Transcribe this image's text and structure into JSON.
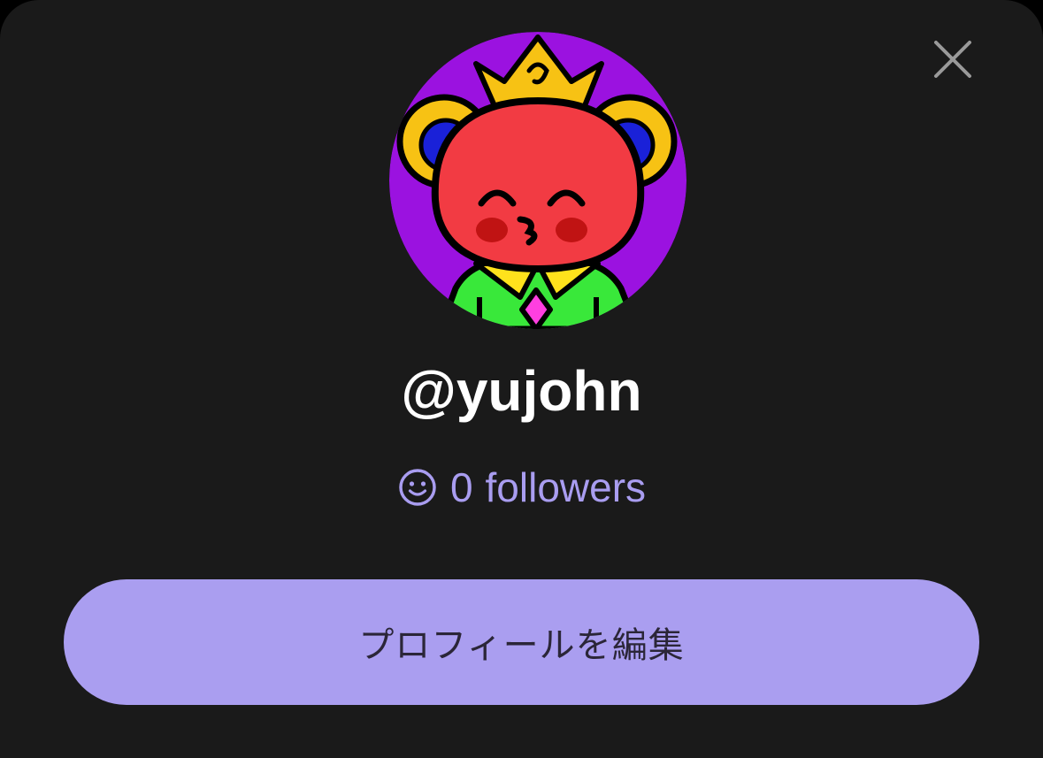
{
  "sheet": {
    "close_icon": "close-icon"
  },
  "profile": {
    "avatar_icon": "bear-avatar-icon",
    "username": "@yujohn",
    "followers_icon": "smiley-icon",
    "followers_count": "0",
    "followers_label": "followers"
  },
  "actions": {
    "edit_profile_label": "プロフィールを編集"
  },
  "colors": {
    "sheet_background": "#1a1a1a",
    "accent": "#aa9ef0",
    "followers_text": "#a99df0",
    "username_text": "#ffffff"
  }
}
